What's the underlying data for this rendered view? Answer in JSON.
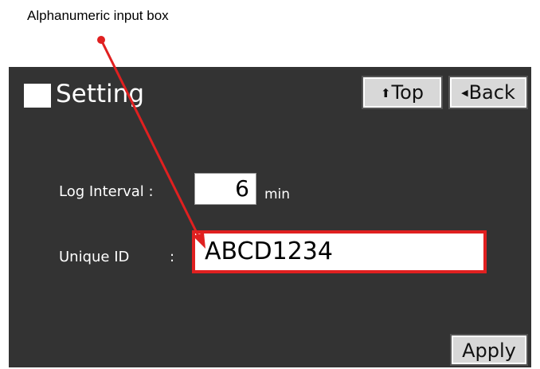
{
  "callout": {
    "label": "Alphanumeric input box",
    "color": "#e02020"
  },
  "screen": {
    "title": "Setting",
    "background": "#333333",
    "buttons": {
      "top": {
        "icon": "up-arrow-icon",
        "glyph": "🡅",
        "label": "Top"
      },
      "back": {
        "icon": "left-triangle-icon",
        "glyph": "◀",
        "label": "Back"
      },
      "apply": {
        "label": "Apply"
      }
    },
    "fields": {
      "log_interval": {
        "label": "Log Interval :",
        "value": "6",
        "unit": "min"
      },
      "unique_id": {
        "label": "Unique ID",
        "colon": ":",
        "value": "ABCD1234"
      }
    }
  }
}
